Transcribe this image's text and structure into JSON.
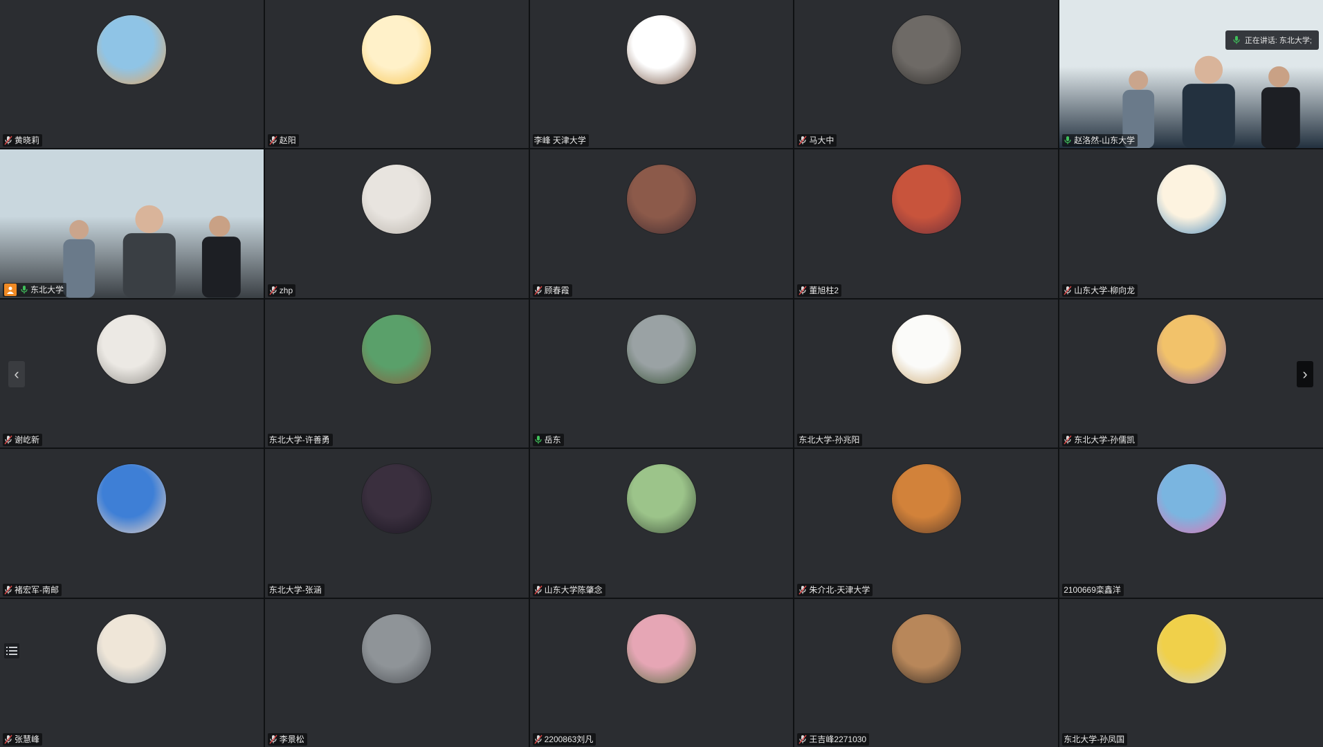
{
  "speaker_label": "正在讲话: 东北大学;",
  "participants": [
    {
      "name": "黄晓莉",
      "mic": "muted",
      "kind": "avatar",
      "colors": [
        "#8fc4e6",
        "#e9a45a"
      ]
    },
    {
      "name": "赵阳",
      "mic": "muted",
      "kind": "avatar",
      "colors": [
        "#fff1c9",
        "#f6c24b"
      ]
    },
    {
      "name": "李峰 天津大学",
      "mic": "none",
      "kind": "avatar",
      "colors": [
        "#ffffff",
        "#6b4a37"
      ]
    },
    {
      "name": "马大中",
      "mic": "muted",
      "kind": "avatar",
      "colors": [
        "#6e6a66",
        "#2c2a28"
      ]
    },
    {
      "name": "赵洛然-山东大学",
      "mic": "on",
      "kind": "video",
      "colors": [
        "#dfe7ea",
        "#23313f"
      ]
    },
    {
      "name": "东北大学",
      "mic": "on",
      "kind": "video",
      "host": true,
      "active": true,
      "colors": [
        "#c9d7de",
        "#3a3f44"
      ]
    },
    {
      "name": "zhp",
      "mic": "muted",
      "kind": "avatar",
      "colors": [
        "#e8e4df",
        "#b8b2aa"
      ]
    },
    {
      "name": "顾春霞",
      "mic": "muted",
      "kind": "avatar",
      "colors": [
        "#8c5a4a",
        "#3d2a30"
      ]
    },
    {
      "name": "董旭柱2",
      "mic": "muted",
      "kind": "avatar",
      "colors": [
        "#c8543c",
        "#6a2d3a"
      ]
    },
    {
      "name": "山东大学-柳向龙",
      "mic": "muted",
      "kind": "avatar",
      "colors": [
        "#fdf3e0",
        "#4a8bbd"
      ]
    },
    {
      "name": "谢屹新",
      "mic": "muted",
      "kind": "avatar",
      "colors": [
        "#ece9e4",
        "#8d8a85"
      ]
    },
    {
      "name": "东北大学-许善勇",
      "mic": "none",
      "kind": "avatar",
      "colors": [
        "#5aa06a",
        "#8c5a3c"
      ]
    },
    {
      "name": "岳东",
      "mic": "on",
      "kind": "avatar",
      "colors": [
        "#9aa2a4",
        "#2f4a2c"
      ]
    },
    {
      "name": "东北大学-孙兆阳",
      "mic": "none",
      "kind": "avatar",
      "colors": [
        "#fbfbf9",
        "#c9a46a"
      ]
    },
    {
      "name": "东北大学-孙儒凯",
      "mic": "muted",
      "kind": "avatar",
      "colors": [
        "#f2c26a",
        "#7a5aa6"
      ]
    },
    {
      "name": "褚宏军-南邮",
      "mic": "muted",
      "kind": "avatar",
      "colors": [
        "#3e7fd6",
        "#f3d7c2"
      ]
    },
    {
      "name": "东北大学-张涵",
      "mic": "none",
      "kind": "avatar",
      "colors": [
        "#3a2f3e",
        "#191520"
      ]
    },
    {
      "name": "山东大学陈肇念",
      "mic": "muted",
      "kind": "avatar",
      "colors": [
        "#9cc48a",
        "#3d4e3a"
      ]
    },
    {
      "name": "朱介北-天津大学",
      "mic": "muted",
      "kind": "avatar",
      "colors": [
        "#d2823a",
        "#5a3b2a"
      ]
    },
    {
      "name": "2100669栾鑫洋",
      "mic": "none",
      "kind": "avatar",
      "colors": [
        "#7ab5e0",
        "#e86fb0"
      ]
    },
    {
      "name": "张慧峰",
      "mic": "muted",
      "kind": "avatar",
      "colors": [
        "#efe6d8",
        "#7e8d9c"
      ]
    },
    {
      "name": "李景松",
      "mic": "muted",
      "kind": "avatar",
      "colors": [
        "#8f9498",
        "#4a4d52"
      ]
    },
    {
      "name": "2200863刘凡",
      "mic": "muted",
      "kind": "avatar",
      "colors": [
        "#e6a6b5",
        "#4d6a3a"
      ]
    },
    {
      "name": "王吉峰2271030",
      "mic": "muted",
      "kind": "avatar",
      "colors": [
        "#b8875a",
        "#2a2420"
      ]
    },
    {
      "name": "东北大学-孙凤国",
      "mic": "none",
      "kind": "avatar",
      "colors": [
        "#f0d04a",
        "#cfd4d8"
      ]
    }
  ],
  "nav": {
    "prev": "‹",
    "next": "›"
  }
}
